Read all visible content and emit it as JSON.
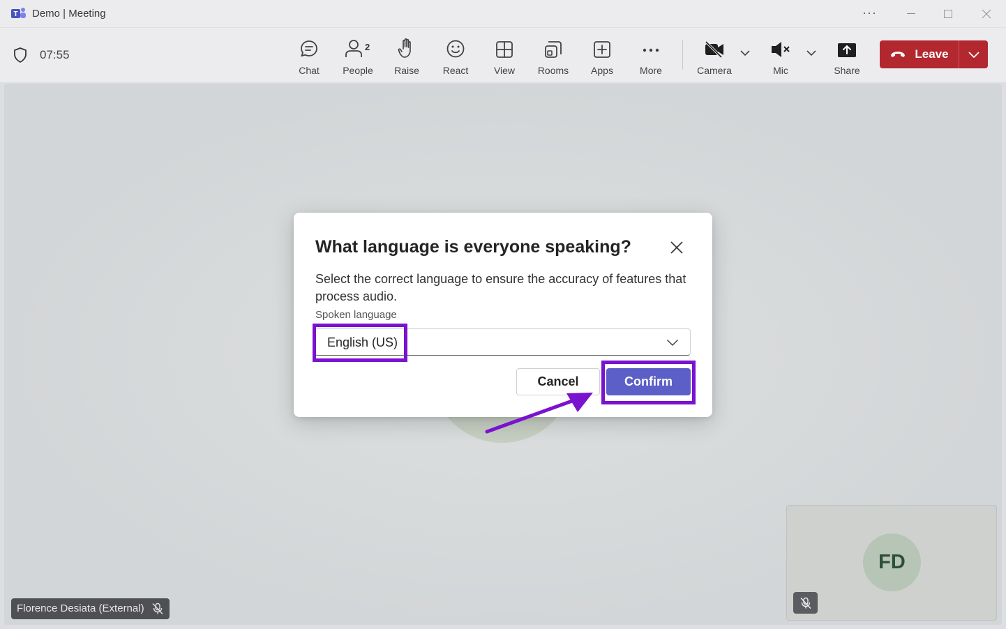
{
  "window": {
    "title": "Demo | Meeting",
    "menu_icon": "more-horizontal-icon",
    "controls": [
      "minimize",
      "maximize",
      "close"
    ]
  },
  "toolbar": {
    "timer": "07:55",
    "tools": [
      {
        "id": "chat",
        "label": "Chat",
        "icon": "chat-icon"
      },
      {
        "id": "people",
        "label": "People",
        "icon": "people-icon",
        "badge": "2"
      },
      {
        "id": "raise",
        "label": "Raise",
        "icon": "hand-icon"
      },
      {
        "id": "react",
        "label": "React",
        "icon": "smile-icon"
      },
      {
        "id": "view",
        "label": "View",
        "icon": "grid-icon"
      },
      {
        "id": "rooms",
        "label": "Rooms",
        "icon": "rooms-icon"
      },
      {
        "id": "apps",
        "label": "Apps",
        "icon": "plus-square-icon"
      },
      {
        "id": "more",
        "label": "More",
        "icon": "ellipsis-icon"
      }
    ],
    "camera": {
      "label": "Camera",
      "icon": "camera-off-icon"
    },
    "mic": {
      "label": "Mic",
      "icon": "speaker-mute-icon"
    },
    "share": {
      "label": "Share",
      "icon": "share-icon"
    },
    "leave": {
      "label": "Leave",
      "color": "#b3272f"
    }
  },
  "stage": {
    "participant_name": "Florence Desiata (External)",
    "self_initials": "FD"
  },
  "dialog": {
    "title": "What language is everyone speaking?",
    "description": "Select the correct language to ensure the accuracy of features that process audio.",
    "field_label": "Spoken language",
    "selected_language": "English (US)",
    "cancel_label": "Cancel",
    "confirm_label": "Confirm",
    "accent": "#5b5fc7"
  },
  "annotations": {
    "highlight_color": "#7a12d0"
  }
}
